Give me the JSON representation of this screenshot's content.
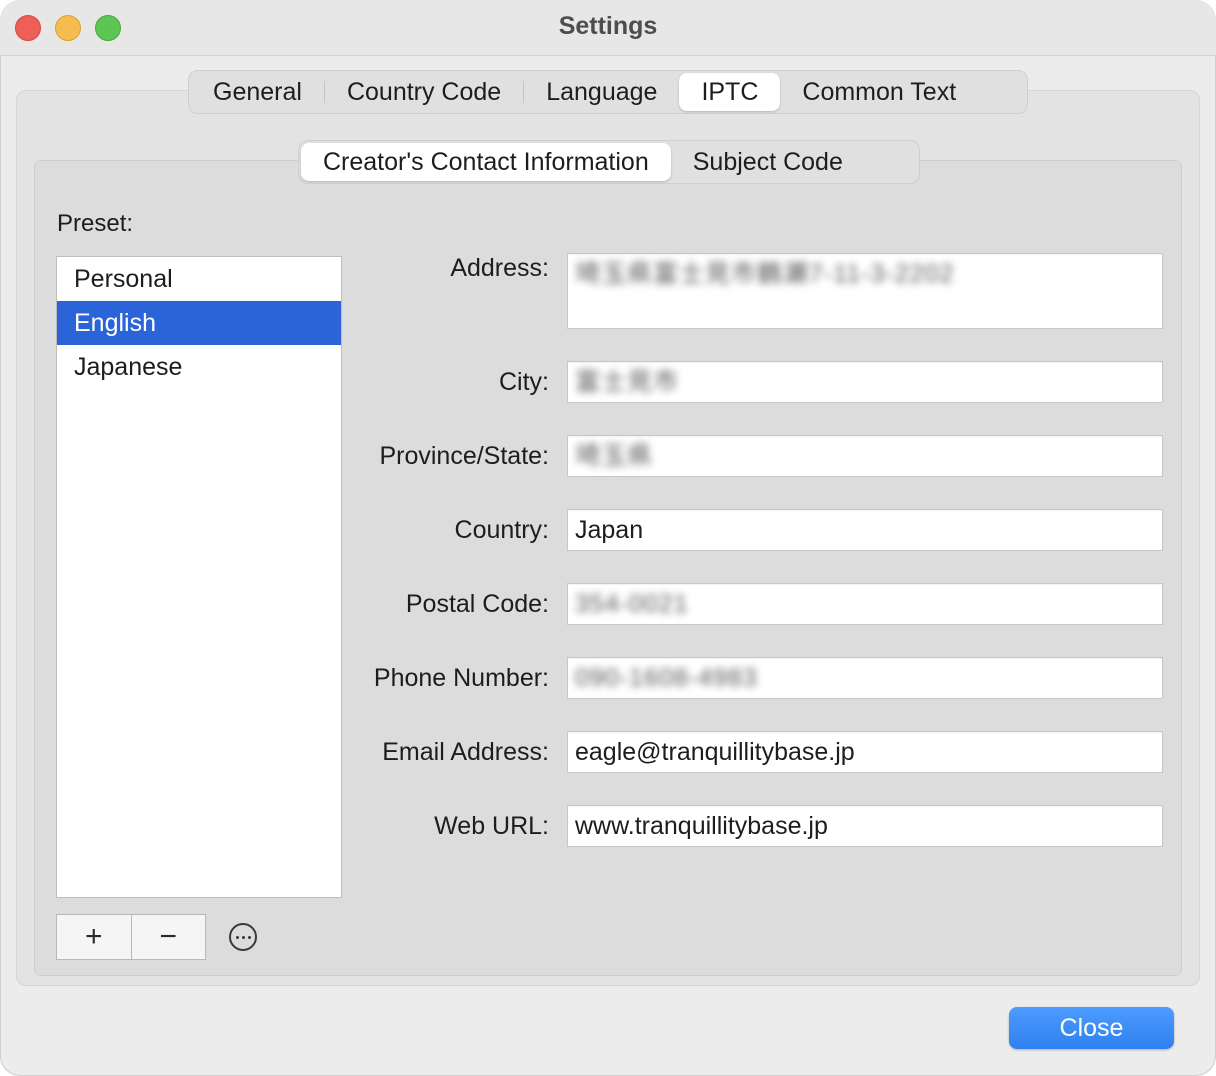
{
  "window": {
    "title": "Settings"
  },
  "main_tabs": [
    {
      "label": "General",
      "selected": false
    },
    {
      "label": "Country Code",
      "selected": false
    },
    {
      "label": "Language",
      "selected": false
    },
    {
      "label": "IPTC",
      "selected": true
    },
    {
      "label": "Common Text",
      "selected": false
    }
  ],
  "sub_tabs": [
    {
      "label": "Creator's Contact Information",
      "selected": true
    },
    {
      "label": "Subject Code",
      "selected": false
    }
  ],
  "preset": {
    "label": "Preset:",
    "items": [
      {
        "label": "Personal",
        "selected": false
      },
      {
        "label": "English",
        "selected": true
      },
      {
        "label": "Japanese",
        "selected": false
      }
    ],
    "add_label": "+",
    "remove_label": "−"
  },
  "fields": {
    "address": {
      "label": "Address:",
      "value": "埼玉県富士見市鶴瀬7-11-3-2202"
    },
    "city": {
      "label": "City:",
      "value": "富士見市"
    },
    "province": {
      "label": "Province/State:",
      "value": "埼玉県"
    },
    "country": {
      "label": "Country:",
      "value": "Japan"
    },
    "postal": {
      "label": "Postal Code:",
      "value": "354-0021"
    },
    "phone": {
      "label": "Phone Number:",
      "value": "090-1608-4983"
    },
    "email": {
      "label": "Email Address:",
      "value": "eagle@tranquillitybase.jp"
    },
    "web": {
      "label": "Web URL:",
      "value": "www.tranquillitybase.jp"
    }
  },
  "close_label": "Close",
  "colors": {
    "accent": "#2b63d9",
    "close_button": "#3a88f7"
  }
}
